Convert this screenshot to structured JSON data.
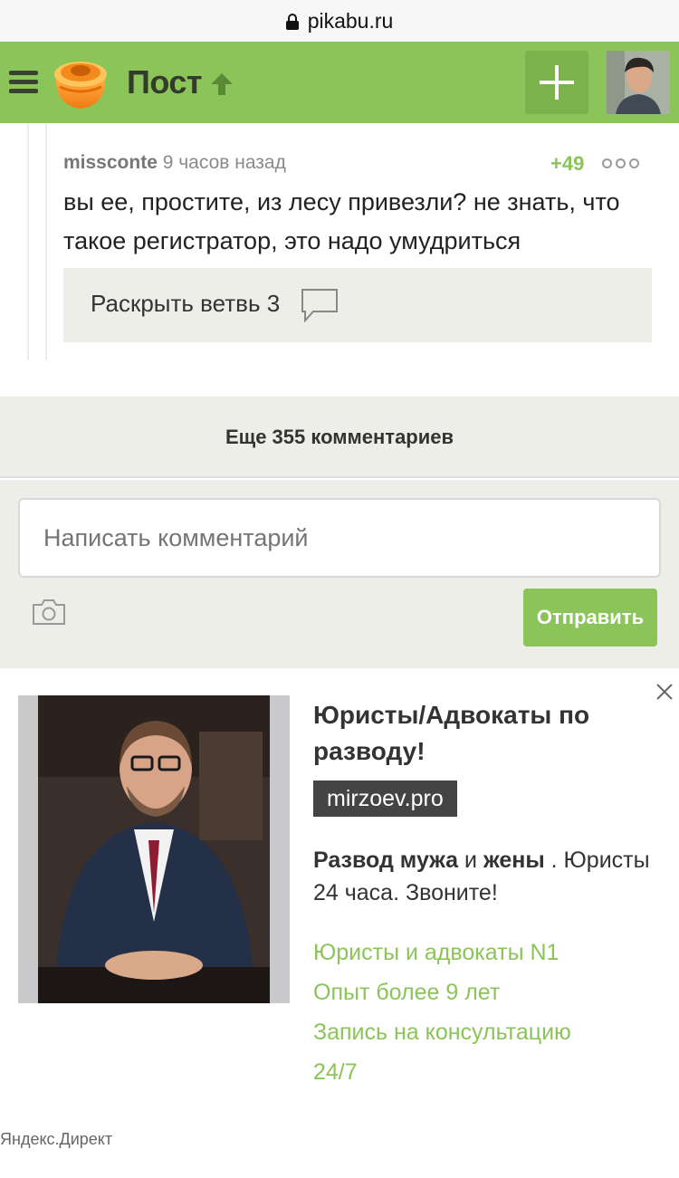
{
  "browser": {
    "url": "pikabu.ru"
  },
  "header": {
    "title": "Пост",
    "colors": {
      "bar": "#8bc459",
      "accent": "#7cb24c"
    }
  },
  "comment": {
    "author": "missconte",
    "time": "9 часов назад",
    "rating": "+49",
    "text": "вы ее, простите, из лесу привезли? не знать, что такое регистратор, это надо умудриться",
    "expand_label": "Раскрыть ветвь 3"
  },
  "more_comments": {
    "label": "Еще 355 комментариев"
  },
  "compose": {
    "placeholder": "Написать комментарий",
    "send_label": "Отправить"
  },
  "ad": {
    "title": "Юристы/Адвокаты по разводу!",
    "domain": "mirzoev.pro",
    "desc_bold_1": "Развод мужа",
    "desc_mid": " и ",
    "desc_bold_2": "жены",
    "desc_rest": " . Юристы 24 часа. Звоните!",
    "links": [
      "Юристы и адвокаты N1",
      "Опыт более 9 лет",
      "Запись на консультацию",
      "24/7"
    ],
    "source": "Яндекс.Директ"
  },
  "icons": [
    "lock-icon",
    "menu-icon",
    "pikabu-logo-icon",
    "arrow-up-icon",
    "plus-icon",
    "more-icon",
    "comment-bubble-icon",
    "camera-icon",
    "close-icon"
  ]
}
